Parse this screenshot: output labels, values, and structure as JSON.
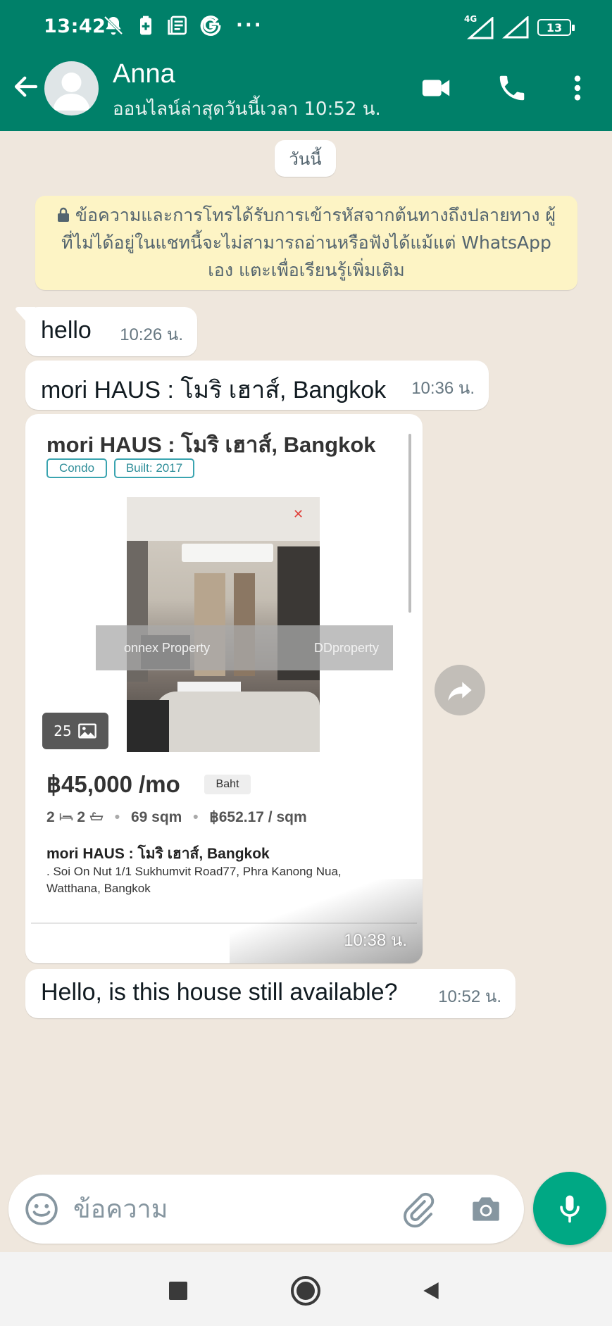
{
  "status_bar": {
    "time": "13:42",
    "network": "4G",
    "battery": "13",
    "icons": [
      "do-not-disturb-icon",
      "battery-saver-icon",
      "notes-icon",
      "google-icon",
      "more-notifications-icon",
      "signal-icon",
      "signal-icon-2"
    ]
  },
  "header": {
    "contact_name": "Anna",
    "last_seen": "ออนไลน์ล่าสุดวันนี้เวลา 10:52 น.",
    "icons": [
      "back-arrow-icon",
      "avatar",
      "video-call-icon",
      "voice-call-icon",
      "overflow-menu-icon"
    ],
    "color": "#008069"
  },
  "chat": {
    "date_label": "วันนี้",
    "encryption_notice": "ข้อความและการโทรได้รับการเข้ารหัสจากต้นทางถึงปลายทาง ผู้ที่ไม่ได้อยู่ในแชทนี้จะไม่สามารถอ่านหรือฟังได้แม้แต่ WhatsApp เอง แตะเพื่อเรียนรู้เพิ่มเติม",
    "messages": [
      {
        "text": "hello",
        "time": "10:26 น."
      },
      {
        "text": "mori HAUS : โมริ เฮาส์, Bangkok",
        "time": "10:36 น."
      },
      {
        "text": "Hello, is this house still available?",
        "time": "10:52 น."
      }
    ],
    "listing": {
      "title": "mori HAUS : โมริ เฮาส์, Bangkok",
      "tags": [
        "Condo",
        "Built: 2017"
      ],
      "watermark_left": "onnex Property",
      "watermark_right": "DDproperty",
      "photo_count": "25",
      "price": "฿45,000 /mo",
      "currency_tag": "Baht",
      "beds": "2",
      "baths": "2",
      "area": "69 sqm",
      "price_per_sqm": "฿652.17 / sqm",
      "name": "mori HAUS : โมริ เฮาส์, Bangkok",
      "address": ". Soi On Nut 1/1 Sukhumvit Road77, Phra Kanong Nua, Watthana, Bangkok",
      "time": "10:38 น."
    }
  },
  "composer": {
    "placeholder": "ข้อความ",
    "value": "",
    "icons": [
      "emoji-icon",
      "attach-icon",
      "camera-icon",
      "microphone-icon"
    ],
    "accent": "#00a884"
  },
  "nav_bar": {
    "icons": [
      "recent-apps-icon",
      "home-icon",
      "back-icon"
    ]
  }
}
